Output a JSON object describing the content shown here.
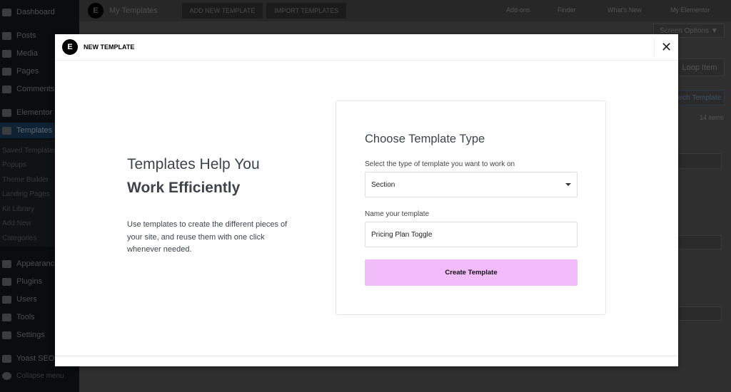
{
  "sidebar": {
    "items": [
      "Dashboard",
      "Posts",
      "Media",
      "Pages",
      "Comments",
      "Elementor",
      "Templates",
      "Appearance",
      "Plugins",
      "Users",
      "Tools",
      "Settings",
      "Yoast SEO",
      "Collapse menu"
    ],
    "submenu": [
      "Saved Templates",
      "Popups",
      "Theme Builder",
      "Landing Pages",
      "Kit Library",
      "Add New",
      "Categories"
    ]
  },
  "topbar": {
    "title": "My Templates",
    "add_new": "ADD NEW TEMPLATE",
    "import": "IMPORT TEMPLATES",
    "addons": "Add-ons",
    "finder": "Finder",
    "whats_new": "What's New",
    "my_elementor": "My Elementor"
  },
  "page": {
    "screen_options": "Screen Options ▼",
    "loop_item": "Loop Item",
    "search": "Search Template",
    "count": "14 items"
  },
  "modal": {
    "title": "NEW TEMPLATE",
    "close": "✕",
    "intro": {
      "line1": "Templates Help You",
      "line2": "Work Efficiently",
      "body": "Use templates to create the different pieces of your site, and reuse them with one click whenever needed."
    },
    "form": {
      "heading": "Choose Template Type",
      "type_label": "Select the type of template you want to work on",
      "type_value": "Section",
      "name_label": "Name your template",
      "name_value": "Pricing Plan Toggle",
      "submit": "Create Template"
    }
  },
  "colors": {
    "accent": "#f2bbf9"
  }
}
